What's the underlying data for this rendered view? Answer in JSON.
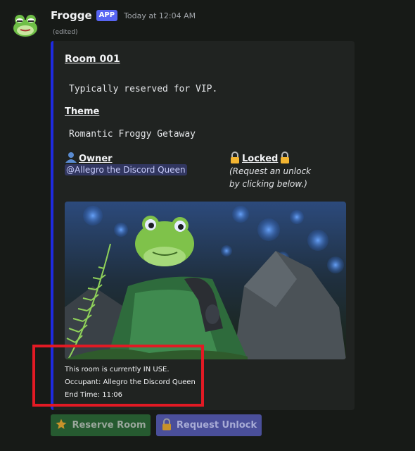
{
  "message": {
    "username": "Frogge",
    "badge": "APP",
    "timestamp": "Today at 12:04 AM",
    "edited": "(edited)"
  },
  "embed": {
    "title": "Room 001",
    "description": "Typically reserved for VIP.",
    "theme_label": "Theme",
    "theme_value": "Romantic Froggy Getaway",
    "owner_label": "Owner",
    "owner_value": "@Allegro the Discord Queen",
    "locked_label": "Locked",
    "locked_line1": "(Request an unlock",
    "locked_line2": "by clicking below.)",
    "footer_line1": "This room is currently IN USE.",
    "footer_line2": "Occupant: Allegro the Discord Queen",
    "footer_line3": "End Time: 11:06"
  },
  "buttons": {
    "reserve": "Reserve Room",
    "unlock": "Request Unlock"
  },
  "colors": {
    "embed_accent": "#1e2adf",
    "badge": "#5865f2",
    "highlight": "#e21a24",
    "reserve_button": "#265a30",
    "unlock_button": "#4a4f9a"
  },
  "icons": [
    "frog-avatar",
    "bust-icon",
    "lock-icon",
    "star-icon"
  ]
}
